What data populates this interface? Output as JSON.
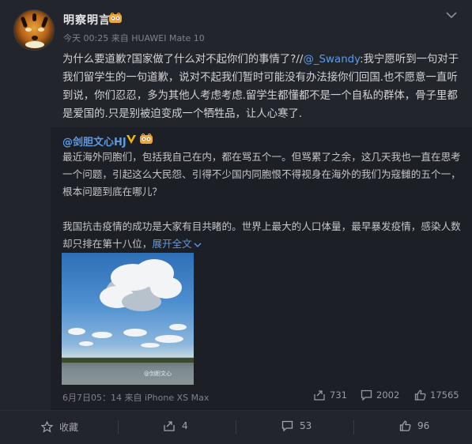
{
  "post": {
    "username": "明察明言",
    "meta": "今天 00:25 来自 HUAWEI Mate 10",
    "text_before": "为什么要道歉?国家做了什么对不起你们的事情了?//",
    "mention": "@_Swandy",
    "text_after": ":我宁愿听到一句对于我们留学生的一句道歉，说对不起我们暂时可能没有办法接你们回国.也不愿意一直听到说，你们忍忍，多为其他人考虑考虑.留学生都懂都不是一个自私的群体，骨子里都是爱国的.只是别被迫变成一个牺牲品，让人心寒了."
  },
  "repost": {
    "author": "@剑胆文心HJ",
    "paragraph1": "最近海外同胞们，包括我自己在内，都在骂五个一。但骂累了之余，这几天我也一直在思考一个问题，引起这么大民怨、引得不少国内同胞恨不得视身在海外的我们为寇雠的五个一，根本问题到底在哪儿？",
    "paragraph2": "我国抗击疫情的成功是大家有目共睹的。世界上最大的人口体量，最早暴发疫情，感染人数却只排在第十八位，",
    "expand": "展开全文",
    "expand_icon": "chevron-down-icon",
    "watermark": "@剑胆文心",
    "meta": "6月7日05：14 来自 iPhone XS Max",
    "stats": {
      "repost": "731",
      "comment": "2002",
      "like": "17565"
    }
  },
  "footer": {
    "favorite": "收藏",
    "repost": "4",
    "comment": "53",
    "like": "96"
  },
  "colors": {
    "background": "#23252d",
    "link": "#5b9be6",
    "repost_bg": "#1d1f26"
  }
}
